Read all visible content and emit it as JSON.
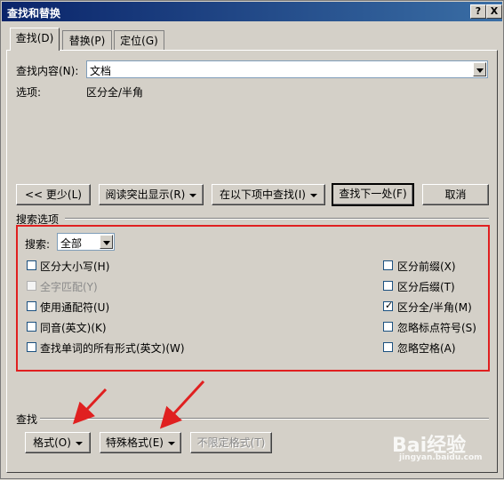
{
  "window": {
    "title": "查找和替换",
    "help_btn": "?",
    "close_btn": "X"
  },
  "tabs": [
    {
      "label": "查找(D)"
    },
    {
      "label": "替换(P)"
    },
    {
      "label": "定位(G)"
    }
  ],
  "find": {
    "label": "查找内容(N):",
    "value": "文档",
    "options_label": "选项:",
    "options_value": "区分全/半角"
  },
  "buttons": {
    "less": "<< 更少(L)",
    "reading_highlight": "阅读突出显示(R)",
    "find_in": "在以下项中查找(I)",
    "find_next": "查找下一处(F)",
    "cancel": "取消"
  },
  "search_options": {
    "heading": "搜索选项",
    "search_label": "搜索:",
    "search_value": "全部",
    "left": [
      {
        "label": "区分大小写(H)",
        "checked": false,
        "disabled": false
      },
      {
        "label": "全字匹配(Y)",
        "checked": false,
        "disabled": true
      },
      {
        "label": "使用通配符(U)",
        "checked": false,
        "disabled": false
      },
      {
        "label": "同音(英文)(K)",
        "checked": false,
        "disabled": false
      },
      {
        "label": "查找单词的所有形式(英文)(W)",
        "checked": false,
        "disabled": false
      }
    ],
    "right": [
      {
        "label": "区分前缀(X)",
        "checked": false,
        "disabled": false
      },
      {
        "label": "区分后缀(T)",
        "checked": false,
        "disabled": false
      },
      {
        "label": "区分全/半角(M)",
        "checked": true,
        "disabled": false
      },
      {
        "label": "忽略标点符号(S)",
        "checked": false,
        "disabled": false
      },
      {
        "label": "忽略空格(A)",
        "checked": false,
        "disabled": false
      }
    ]
  },
  "find_section": {
    "heading": "查找",
    "format": "格式(O)",
    "special": "特殊格式(E)",
    "no_format": "不限定格式(T)"
  },
  "watermark": {
    "brand": "Bai经验",
    "url": "jingyan.baidu.com"
  },
  "colors": {
    "annotation": "#e02020",
    "titlebar": "#0a246a"
  }
}
